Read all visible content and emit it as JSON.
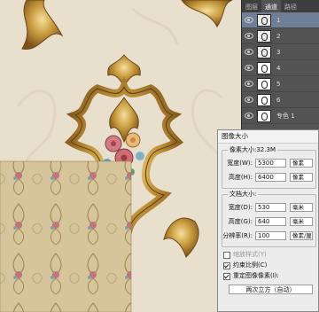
{
  "layers_panel": {
    "tabs": [
      "图层",
      "通道",
      "路径"
    ],
    "active_tab": 1,
    "layers": [
      {
        "name": "1",
        "thumb": "checker"
      },
      {
        "name": "2",
        "thumb": "checker"
      },
      {
        "name": "3",
        "thumb": "checker"
      },
      {
        "name": "4",
        "thumb": "white"
      },
      {
        "name": "5",
        "thumb": "white"
      },
      {
        "name": "6",
        "thumb": "white"
      },
      {
        "name": "专色 1",
        "thumb": "white"
      }
    ],
    "selected_index": 0
  },
  "image_size_dialog": {
    "title": "图像大小",
    "pixel_dimensions": "像素大小:32.3M",
    "width_label": "宽度(W):",
    "width_value": "5300",
    "width_unit": "像素",
    "height_label": "高度(H):",
    "height_value": "6400",
    "height_unit": "像素",
    "doc_size_label": "文档大小:",
    "doc_width_label": "宽度(D):",
    "doc_width_value": "530",
    "doc_width_unit": "毫米",
    "doc_height_label": "高度(G):",
    "doc_height_value": "640",
    "doc_height_unit": "毫米",
    "resolution_label": "分辨率(R):",
    "resolution_value": "100",
    "resolution_unit": "像素/厘米",
    "scale_styles": "缩放样式(Y)",
    "constrain": "约束比例(C)",
    "resample": "重定图像像素(I):",
    "resample_method": "两次立方（自动）"
  },
  "colors": {
    "canvas_bg": "#e6dcc9",
    "wallpaper_bg": "#d8c9a0",
    "gold": "#b8892f"
  }
}
